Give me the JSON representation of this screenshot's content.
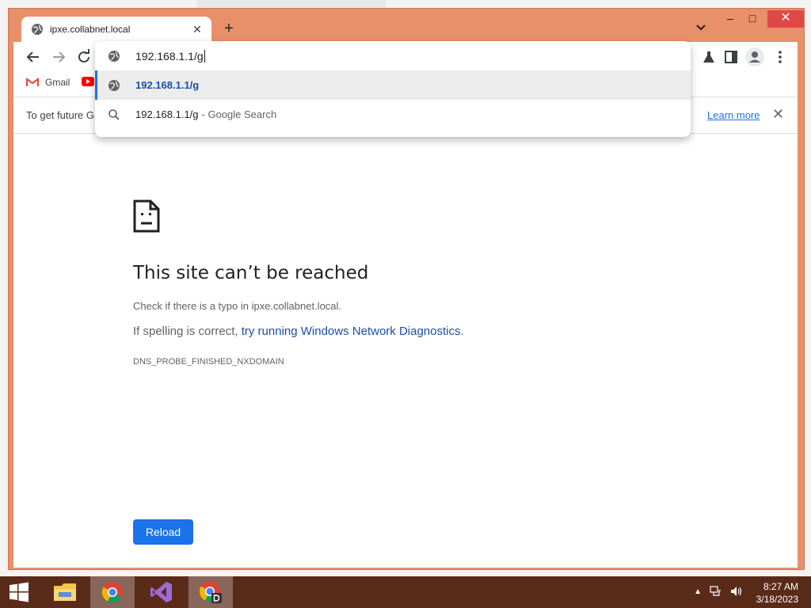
{
  "browser": {
    "tab": {
      "title": "ipxe.collabnet.local",
      "close": "✕"
    },
    "new_tab": "+",
    "window_controls": {
      "minimize": "–",
      "maximize": "□",
      "close": "✕"
    }
  },
  "omnibox": {
    "input_value": "192.168.1.1/g",
    "suggestions": [
      {
        "type": "url",
        "text": "192.168.1.1/g",
        "icon": "globe-icon"
      },
      {
        "type": "search",
        "text": "192.168.1.1/g",
        "suffix": "- Google Search",
        "icon": "search-icon"
      }
    ]
  },
  "bookmarks": [
    {
      "label": "Gmail",
      "icon": "gmail-icon"
    },
    {
      "label": "",
      "icon": "youtube-icon"
    }
  ],
  "infobar": {
    "text": "To get future G",
    "learn_more": "Learn more",
    "close": "✕"
  },
  "error_page": {
    "title": "This site can’t be reached",
    "line1": "Check if there is a typo in ipxe.collabnet.local.",
    "line2_prefix": "If spelling is correct, ",
    "line2_link": "try running Windows Network Diagnostics",
    "line2_suffix": ".",
    "error_code": "DNS_PROBE_FINISHED_NXDOMAIN",
    "reload_label": "Reload"
  },
  "taskbar": {
    "clock_time": "8:27 AM",
    "clock_date": "3/18/2023"
  },
  "colors": {
    "window_frame": "#e8906a",
    "accent_blue": "#1a73e8",
    "taskbar": "#5b2b1a"
  }
}
